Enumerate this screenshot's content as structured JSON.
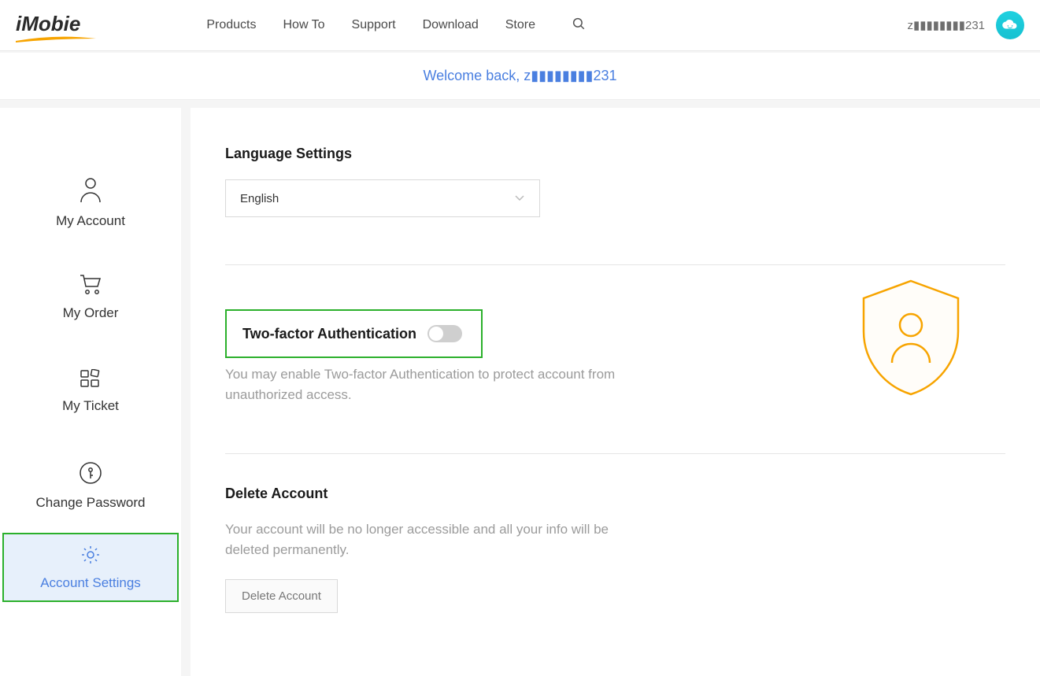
{
  "brand": "iMobie",
  "nav": {
    "items": [
      "Products",
      "How To",
      "Support",
      "Download",
      "Store"
    ]
  },
  "header": {
    "username": "z▮▮▮▮▮▮▮▮231"
  },
  "welcome": {
    "text": "Welcome back, z▮▮▮▮▮▮▮▮231"
  },
  "sidebar": {
    "items": [
      {
        "label": "My Account"
      },
      {
        "label": "My Order"
      },
      {
        "label": "My Ticket"
      },
      {
        "label": "Change Password"
      },
      {
        "label": "Account Settings"
      }
    ]
  },
  "language": {
    "title": "Language Settings",
    "selected": "English"
  },
  "twofa": {
    "title": "Two-factor Authentication",
    "enabled": false,
    "desc": "You may enable Two-factor Authentication to protect account from unauthorized access."
  },
  "delete": {
    "title": "Delete Account",
    "desc": "Your account will be no longer accessible and all your info will be deleted permanently.",
    "button": "Delete Account"
  },
  "colors": {
    "accent_orange": "#f7a400",
    "link_blue": "#4a7fe0",
    "highlight_green": "#2bb02b"
  }
}
